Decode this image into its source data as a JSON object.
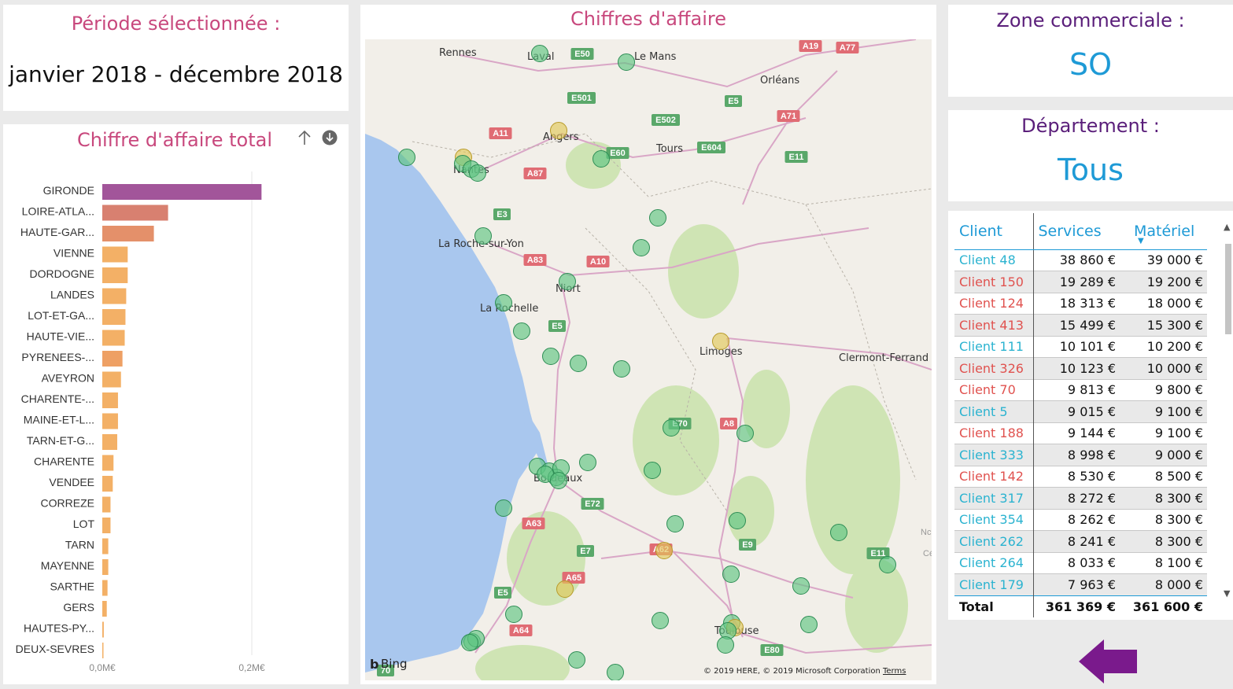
{
  "period": {
    "title": "Période sélectionnée :",
    "value": "janvier 2018 - décembre 2018"
  },
  "zone": {
    "title": "Zone commerciale :",
    "value": "SO"
  },
  "department": {
    "title": "Département :",
    "value": "Tous"
  },
  "map": {
    "title": "Chiffres d'affaire",
    "bing": "Bing",
    "copyright": "© 2019 HERE, © 2019 Microsoft Corporation",
    "terms": "Terms",
    "cities": [
      "Rennes",
      "Laval",
      "Le Mans",
      "Orléans",
      "Angers",
      "Tours",
      "Nantes",
      "La Roche-sur-Yon",
      "Niort",
      "La Rochelle",
      "Limoges",
      "Clermont-Ferrand",
      "Bordeaux",
      "Toulouse"
    ],
    "roads": [
      "A19",
      "A77",
      "E50",
      "E501",
      "E5",
      "A71",
      "E502",
      "A11",
      "E60",
      "E604",
      "E11",
      "A87",
      "E3",
      "A83",
      "A10",
      "E5",
      "E70",
      "A8",
      "E72",
      "A63",
      "E7",
      "A62",
      "E9",
      "E11",
      "A65",
      "E5",
      "A64",
      "E80",
      "70",
      "Nc",
      "Cé"
    ]
  },
  "bar_chart_data": {
    "type": "bar",
    "title": "Chiffre d'affaire total",
    "categories": [
      "GIRONDE",
      "LOIRE-ATLA...",
      "HAUTE-GAR...",
      "VIENNE",
      "DORDOGNE",
      "LANDES",
      "LOT-ET-GA...",
      "HAUTE-VIE...",
      "PYRENEES-...",
      "AVEYRON",
      "CHARENTE-...",
      "MAINE-ET-L...",
      "TARN-ET-G...",
      "CHARENTE",
      "VENDEE",
      "CORREZE",
      "LOT",
      "TARN",
      "MAYENNE",
      "SARTHE",
      "GERS",
      "HAUTES-PY...",
      "DEUX-SEVRES"
    ],
    "values": [
      0.213,
      0.088,
      0.069,
      0.034,
      0.034,
      0.032,
      0.031,
      0.03,
      0.027,
      0.025,
      0.021,
      0.021,
      0.02,
      0.015,
      0.014,
      0.011,
      0.011,
      0.008,
      0.008,
      0.007,
      0.006,
      0.002,
      0.001
    ],
    "colors": [
      "#a2559a",
      "#d88070",
      "#e4906a",
      "#f3b066",
      "#f3b066",
      "#f3b066",
      "#f3b066",
      "#f3b066",
      "#eea064",
      "#f3b066",
      "#f3b066",
      "#f3b066",
      "#f3b066",
      "#f3b066",
      "#f3b066",
      "#f3b066",
      "#f3b066",
      "#f3b066",
      "#f3b066",
      "#f3b066",
      "#f3b066",
      "#f3b066",
      "#f3b066"
    ],
    "xticks": [
      "0,0M€",
      "0,2M€"
    ],
    "xlim": [
      0,
      0.2
    ],
    "unit": "M€",
    "grid": true
  },
  "table": {
    "headers": {
      "client": "Client",
      "services": "Services",
      "materiel": "Matériel"
    },
    "rows": [
      {
        "client": "Client 48",
        "services": "38 860 €",
        "materiel": "39 000 €",
        "color": "#2bb3d0"
      },
      {
        "client": "Client 150",
        "services": "19 289 €",
        "materiel": "19 200 €",
        "color": "#e0524f"
      },
      {
        "client": "Client 124",
        "services": "18 313 €",
        "materiel": "18 000 €",
        "color": "#e0524f"
      },
      {
        "client": "Client 413",
        "services": "15 499 €",
        "materiel": "15 300 €",
        "color": "#e0524f"
      },
      {
        "client": "Client 111",
        "services": "10 101 €",
        "materiel": "10 200 €",
        "color": "#2bb3d0"
      },
      {
        "client": "Client 326",
        "services": "10 123 €",
        "materiel": "10 000 €",
        "color": "#e0524f"
      },
      {
        "client": "Client 70",
        "services": "9 813 €",
        "materiel": "9 800 €",
        "color": "#e0524f"
      },
      {
        "client": "Client 5",
        "services": "9 015 €",
        "materiel": "9 100 €",
        "color": "#2bb3d0"
      },
      {
        "client": "Client 188",
        "services": "9 144 €",
        "materiel": "9 100 €",
        "color": "#e0524f"
      },
      {
        "client": "Client 333",
        "services": "8 998 €",
        "materiel": "9 000 €",
        "color": "#2bb3d0"
      },
      {
        "client": "Client 142",
        "services": "8 530 €",
        "materiel": "8 500 €",
        "color": "#e0524f"
      },
      {
        "client": "Client 317",
        "services": "8 272 €",
        "materiel": "8 300 €",
        "color": "#2bb3d0"
      },
      {
        "client": "Client 354",
        "services": "8 262 €",
        "materiel": "8 300 €",
        "color": "#2bb3d0"
      },
      {
        "client": "Client 262",
        "services": "8 241 €",
        "materiel": "8 300 €",
        "color": "#2bb3d0"
      },
      {
        "client": "Client 264",
        "services": "8 033 €",
        "materiel": "8 100 €",
        "color": "#2bb3d0"
      },
      {
        "client": "Client 179",
        "services": "7 963 €",
        "materiel": "8 000 €",
        "color": "#2bb3d0"
      }
    ],
    "total": {
      "label": "Total",
      "services": "361 369 €",
      "materiel": "361 600 €"
    }
  },
  "colors": {
    "title_pink": "#c8487d",
    "title_purple": "#5a1e7a",
    "accent_blue": "#1e9ad6",
    "arrow_purple": "#7a1a8c"
  }
}
